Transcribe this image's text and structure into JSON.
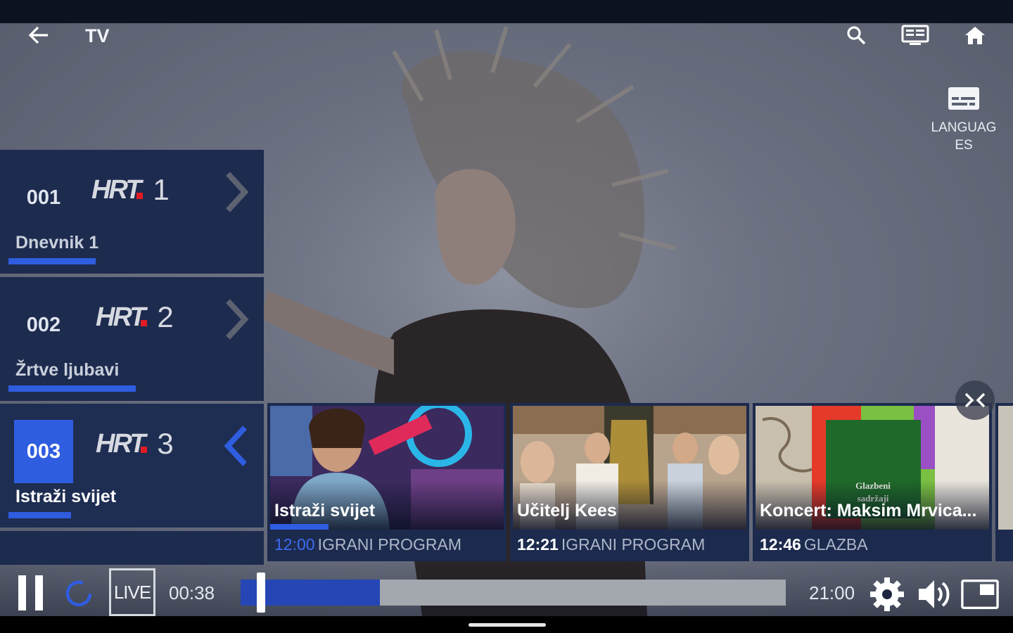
{
  "header": {
    "title": "TV",
    "icons": [
      "back-arrow-icon",
      "search-icon",
      "tv-guide-icon",
      "home-icon"
    ]
  },
  "language_button": {
    "icon": "subtitles-icon",
    "label": "LANGUAGES"
  },
  "channels": [
    {
      "number": "001",
      "logo_text": "HRT",
      "logo_number": "1",
      "show": "Dnevnik 1",
      "progress": 0.35,
      "active": false
    },
    {
      "number": "002",
      "logo_text": "HRT",
      "logo_number": "2",
      "show": "Žrtve ljubavi",
      "progress": 0.51,
      "active": false
    },
    {
      "number": "003",
      "logo_text": "HRT",
      "logo_number": "3",
      "show": "Istraži svijet",
      "progress": 0.25,
      "active": true
    }
  ],
  "programs": [
    {
      "title": "Istraži svijet",
      "time": "12:00",
      "genre": "IGRANI PROGRAM",
      "current": true,
      "progress": 0.25
    },
    {
      "title": "Učitelj Kees",
      "time": "12:21",
      "genre": "IGRANI PROGRAM",
      "current": false
    },
    {
      "title": "Koncert: Maksim Mrvica...",
      "time": "12:46",
      "genre": "GLAZBA",
      "current": false,
      "thumb_text": "Glazbeni sadržaji"
    }
  ],
  "player": {
    "live_label": "LIVE",
    "elapsed": "00:38",
    "duration": "21:00",
    "buffered": 0.255,
    "position": 0.03
  },
  "colors": {
    "accent": "#2f5de0",
    "panel": "#1d2b4f",
    "background": "#0c1220"
  }
}
